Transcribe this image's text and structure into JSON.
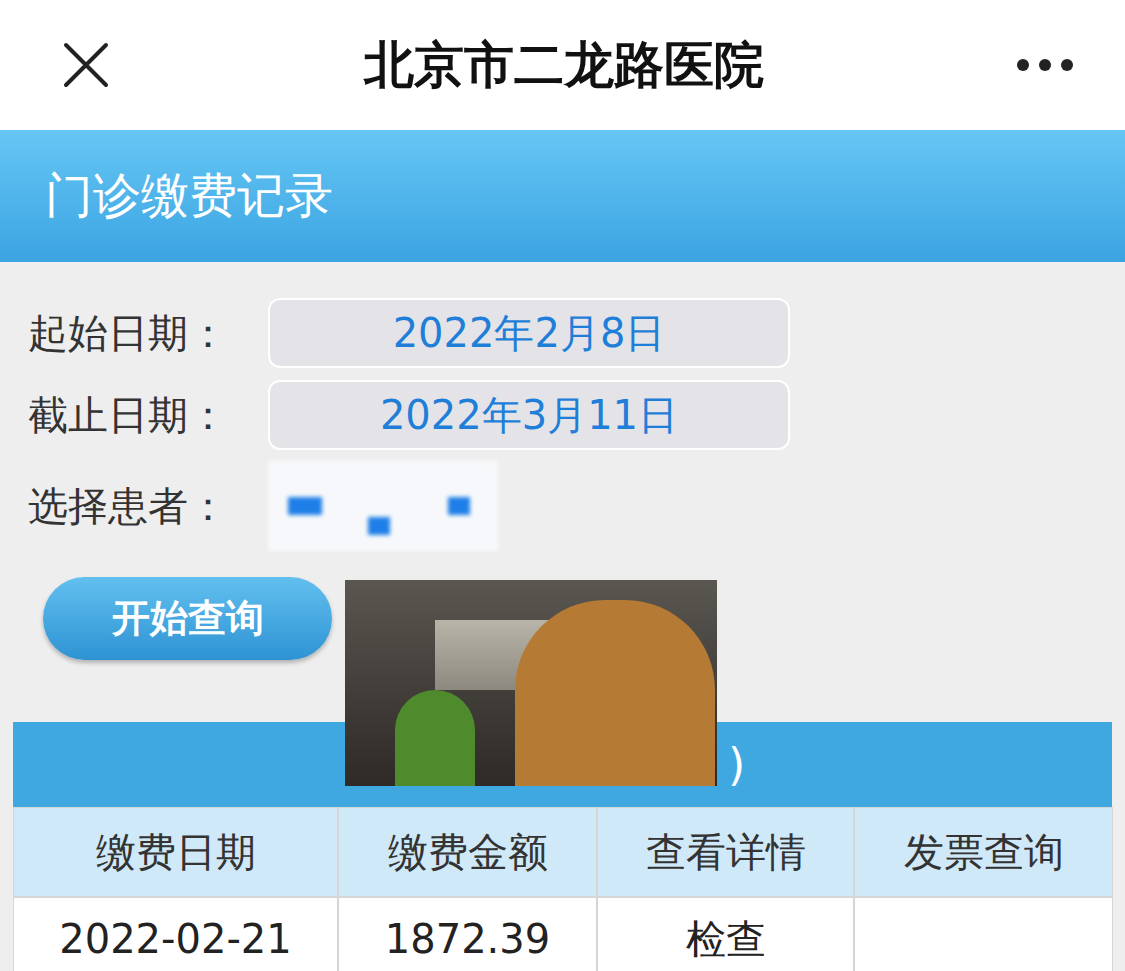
{
  "nav": {
    "title": "北京市二龙路医院"
  },
  "header": {
    "title": "门诊缴费记录"
  },
  "form": {
    "fields": [
      {
        "label": "起始日期：",
        "value": "2022年2月8日"
      },
      {
        "label": "截止日期：",
        "value": "2022年3月11日"
      }
    ],
    "patient": {
      "label": "选择患者："
    }
  },
  "query_button": "开始查询",
  "table": {
    "caption": ")",
    "columns": [
      "缴费日期",
      "缴费金额",
      "查看详情",
      "发票查询"
    ],
    "rows": [
      {
        "date": "2022-02-21",
        "amount": "1872.39",
        "detail": "检查"
      }
    ]
  }
}
